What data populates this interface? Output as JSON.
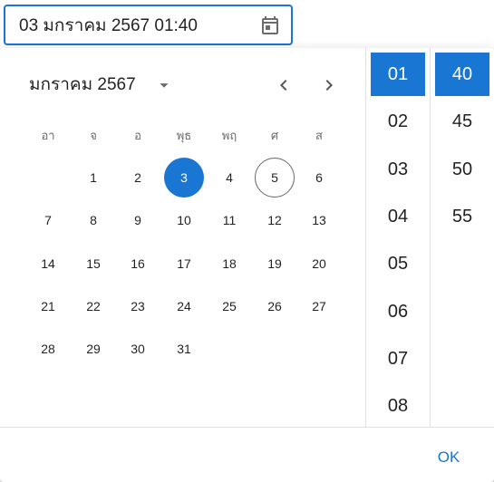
{
  "input": {
    "value": "03 มกราคม 2567 01:40",
    "icon": "calendar-icon"
  },
  "calendar": {
    "month_label": "มกราคม 2567",
    "weekdays": [
      "อา",
      "จ",
      "อ",
      "พุธ",
      "พฤ",
      "ศ",
      "ส"
    ],
    "first_weekday_index": 1,
    "days": [
      "1",
      "2",
      "3",
      "4",
      "5",
      "6",
      "7",
      "8",
      "9",
      "10",
      "11",
      "12",
      "13",
      "14",
      "15",
      "16",
      "17",
      "18",
      "19",
      "20",
      "21",
      "22",
      "23",
      "24",
      "25",
      "26",
      "27",
      "28",
      "29",
      "30",
      "31"
    ],
    "selected_day": "3",
    "today_day": "5"
  },
  "time": {
    "hours": [
      "01",
      "02",
      "03",
      "04",
      "05",
      "06",
      "07",
      "08"
    ],
    "selected_hour": "01",
    "minutes": [
      "40",
      "45",
      "50",
      "55"
    ],
    "selected_minute": "40"
  },
  "actions": {
    "ok_label": "OK"
  },
  "colors": {
    "accent": "#1976d2"
  }
}
